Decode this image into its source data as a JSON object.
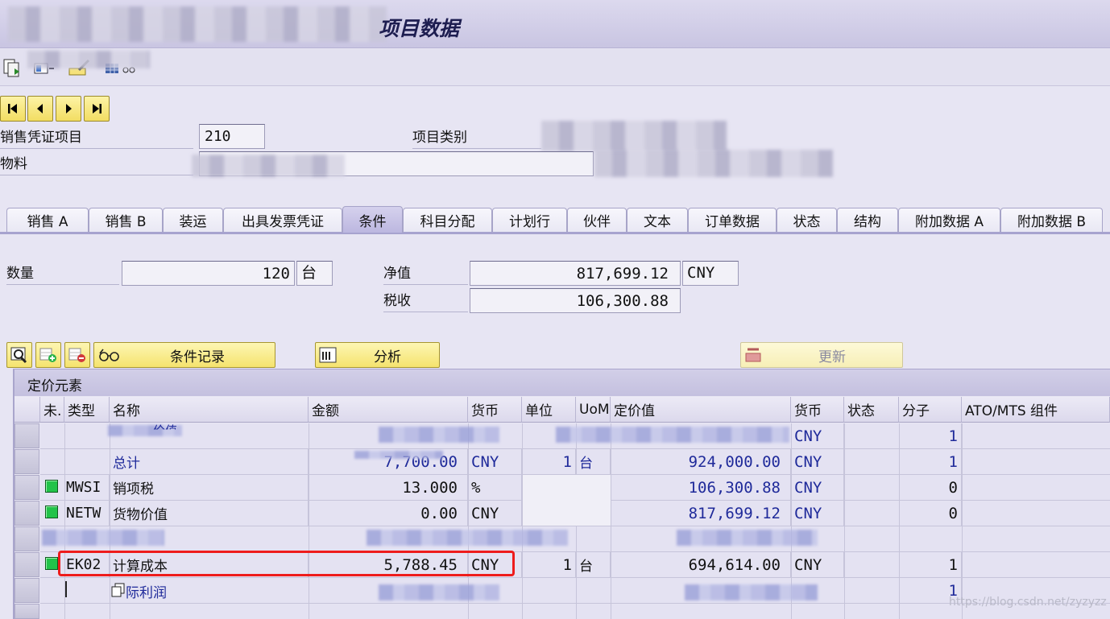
{
  "window": {
    "title_visible": "项目数据"
  },
  "header": {
    "sales_item_label": "销售凭证项目",
    "sales_item_value": "210",
    "item_category_label": "项目类别",
    "material_label": "物料"
  },
  "tabs": [
    {
      "label": "销售 A"
    },
    {
      "label": "销售 B"
    },
    {
      "label": "装运"
    },
    {
      "label": "出具发票凭证"
    },
    {
      "label": "条件",
      "active": true
    },
    {
      "label": "科目分配"
    },
    {
      "label": "计划行"
    },
    {
      "label": "伙伴"
    },
    {
      "label": "文本"
    },
    {
      "label": "订单数据"
    },
    {
      "label": "状态"
    },
    {
      "label": "结构"
    },
    {
      "label": "附加数据 A"
    },
    {
      "label": "附加数据 B"
    }
  ],
  "summary": {
    "quantity_label": "数量",
    "quantity_value": "120",
    "quantity_unit": "台",
    "net_value_label": "净值",
    "net_value": "817,699.12",
    "net_currency": "CNY",
    "tax_label": "税收",
    "tax_value": "106,300.88"
  },
  "buttons": {
    "condition_record": "条件记录",
    "analysis": "分析",
    "update": "更新"
  },
  "table": {
    "group_title": "定价元素",
    "columns": [
      "未.",
      "类型",
      "名称",
      "金额",
      "货币",
      "单位",
      "UoM",
      "定价值",
      "货币",
      "状态",
      "分子",
      "ATO/MTS 组件"
    ],
    "rows": [
      {
        "name_tail": "价值",
        "currency2": "CNY",
        "numerator": "1"
      },
      {
        "name": "总计",
        "amount": "7,700.00",
        "currency": "CNY",
        "unit": "1",
        "uom": "台",
        "price_value": "924,000.00",
        "currency2": "CNY",
        "numerator": "1"
      },
      {
        "type": "MWSI",
        "name": "销项税",
        "amount": "13.000",
        "currency": "%",
        "price_value": "106,300.88",
        "currency2": "CNY",
        "numerator": "0"
      },
      {
        "type": "NETW",
        "name": "货物价值",
        "amount": "0.00",
        "currency": "CNY",
        "price_value": "817,699.12",
        "currency2": "CNY",
        "numerator": "0"
      },
      {},
      {
        "type": "EK02",
        "name": "计算成本",
        "amount": "5,788.45",
        "currency": "CNY",
        "unit": "1",
        "uom": "台",
        "price_value": "694,614.00",
        "currency2": "CNY",
        "numerator": "1"
      },
      {
        "name_tail": "际利润",
        "numerator": "1"
      }
    ]
  },
  "watermark": "https://blog.csdn.net/zyzyzz",
  "colors": {
    "status_active": "#22c34a",
    "highlight": "#ee1c1c",
    "button_yellow": "#f5e36e",
    "tab_active": "#bcb7e0"
  }
}
